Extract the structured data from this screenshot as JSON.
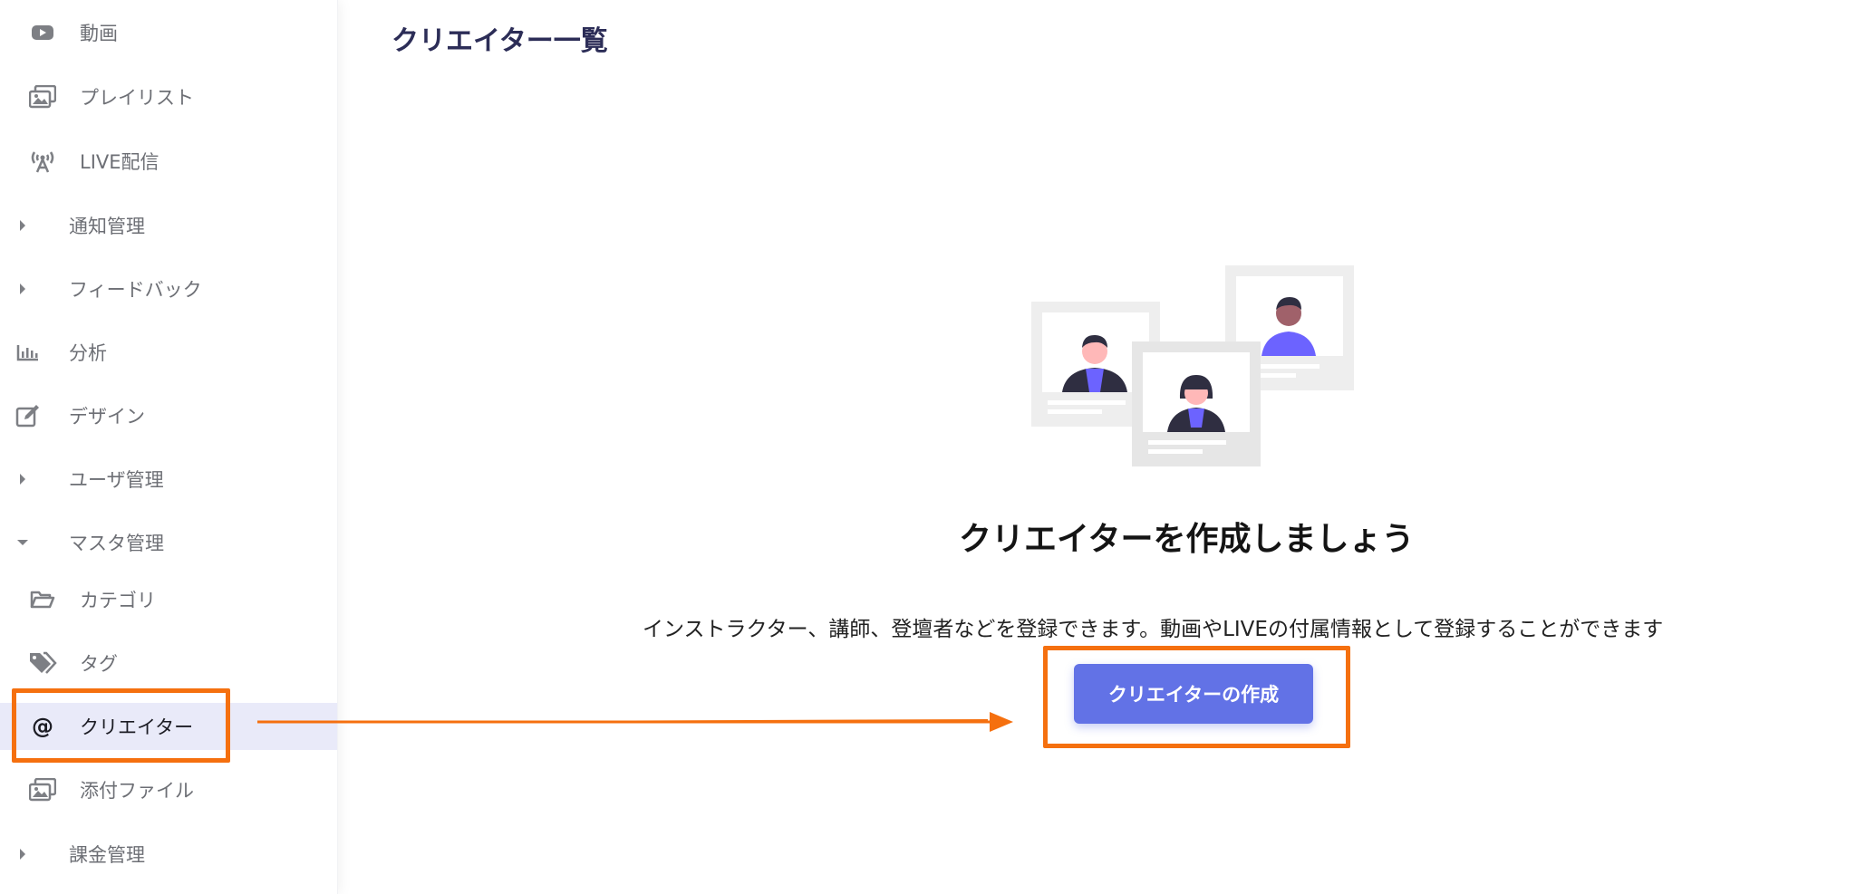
{
  "sidebar": {
    "items": [
      {
        "label": "動画",
        "icon": "youtube-icon",
        "kind": "child"
      },
      {
        "label": "プレイリスト",
        "icon": "images-icon",
        "kind": "child"
      },
      {
        "label": "LIVE配信",
        "icon": "broadcast-icon",
        "kind": "child"
      },
      {
        "label": "通知管理",
        "icon": "caret-right-icon",
        "kind": "group"
      },
      {
        "label": "フィードバック",
        "icon": "caret-right-icon",
        "kind": "group"
      },
      {
        "label": "分析",
        "icon": "bar-chart-icon",
        "kind": "top"
      },
      {
        "label": "デザイン",
        "icon": "edit-icon",
        "kind": "top"
      },
      {
        "label": "ユーザ管理",
        "icon": "caret-right-icon",
        "kind": "group"
      },
      {
        "label": "マスタ管理",
        "icon": "caret-down-icon",
        "kind": "group"
      },
      {
        "label": "カテゴリ",
        "icon": "folder-open-icon",
        "kind": "child"
      },
      {
        "label": "タグ",
        "icon": "tags-icon",
        "kind": "child"
      },
      {
        "label": "クリエイター",
        "icon": "at-icon",
        "kind": "child",
        "active": true
      },
      {
        "label": "添付ファイル",
        "icon": "images-icon",
        "kind": "child"
      },
      {
        "label": "課金管理",
        "icon": "caret-right-icon",
        "kind": "group"
      }
    ]
  },
  "main": {
    "page_title": "クリエイター一覧",
    "empty_state": {
      "title": "クリエイターを作成しましょう",
      "description": "インストラクター、講師、登壇者などを登録できます。動画やLIVEの付属情報として登録することができます",
      "button_label": "クリエイターの作成"
    }
  },
  "colors": {
    "accent": "#6272e6",
    "active_bg": "#e9eaf9",
    "annotation": "#f5700f",
    "title": "#2c2d57"
  }
}
